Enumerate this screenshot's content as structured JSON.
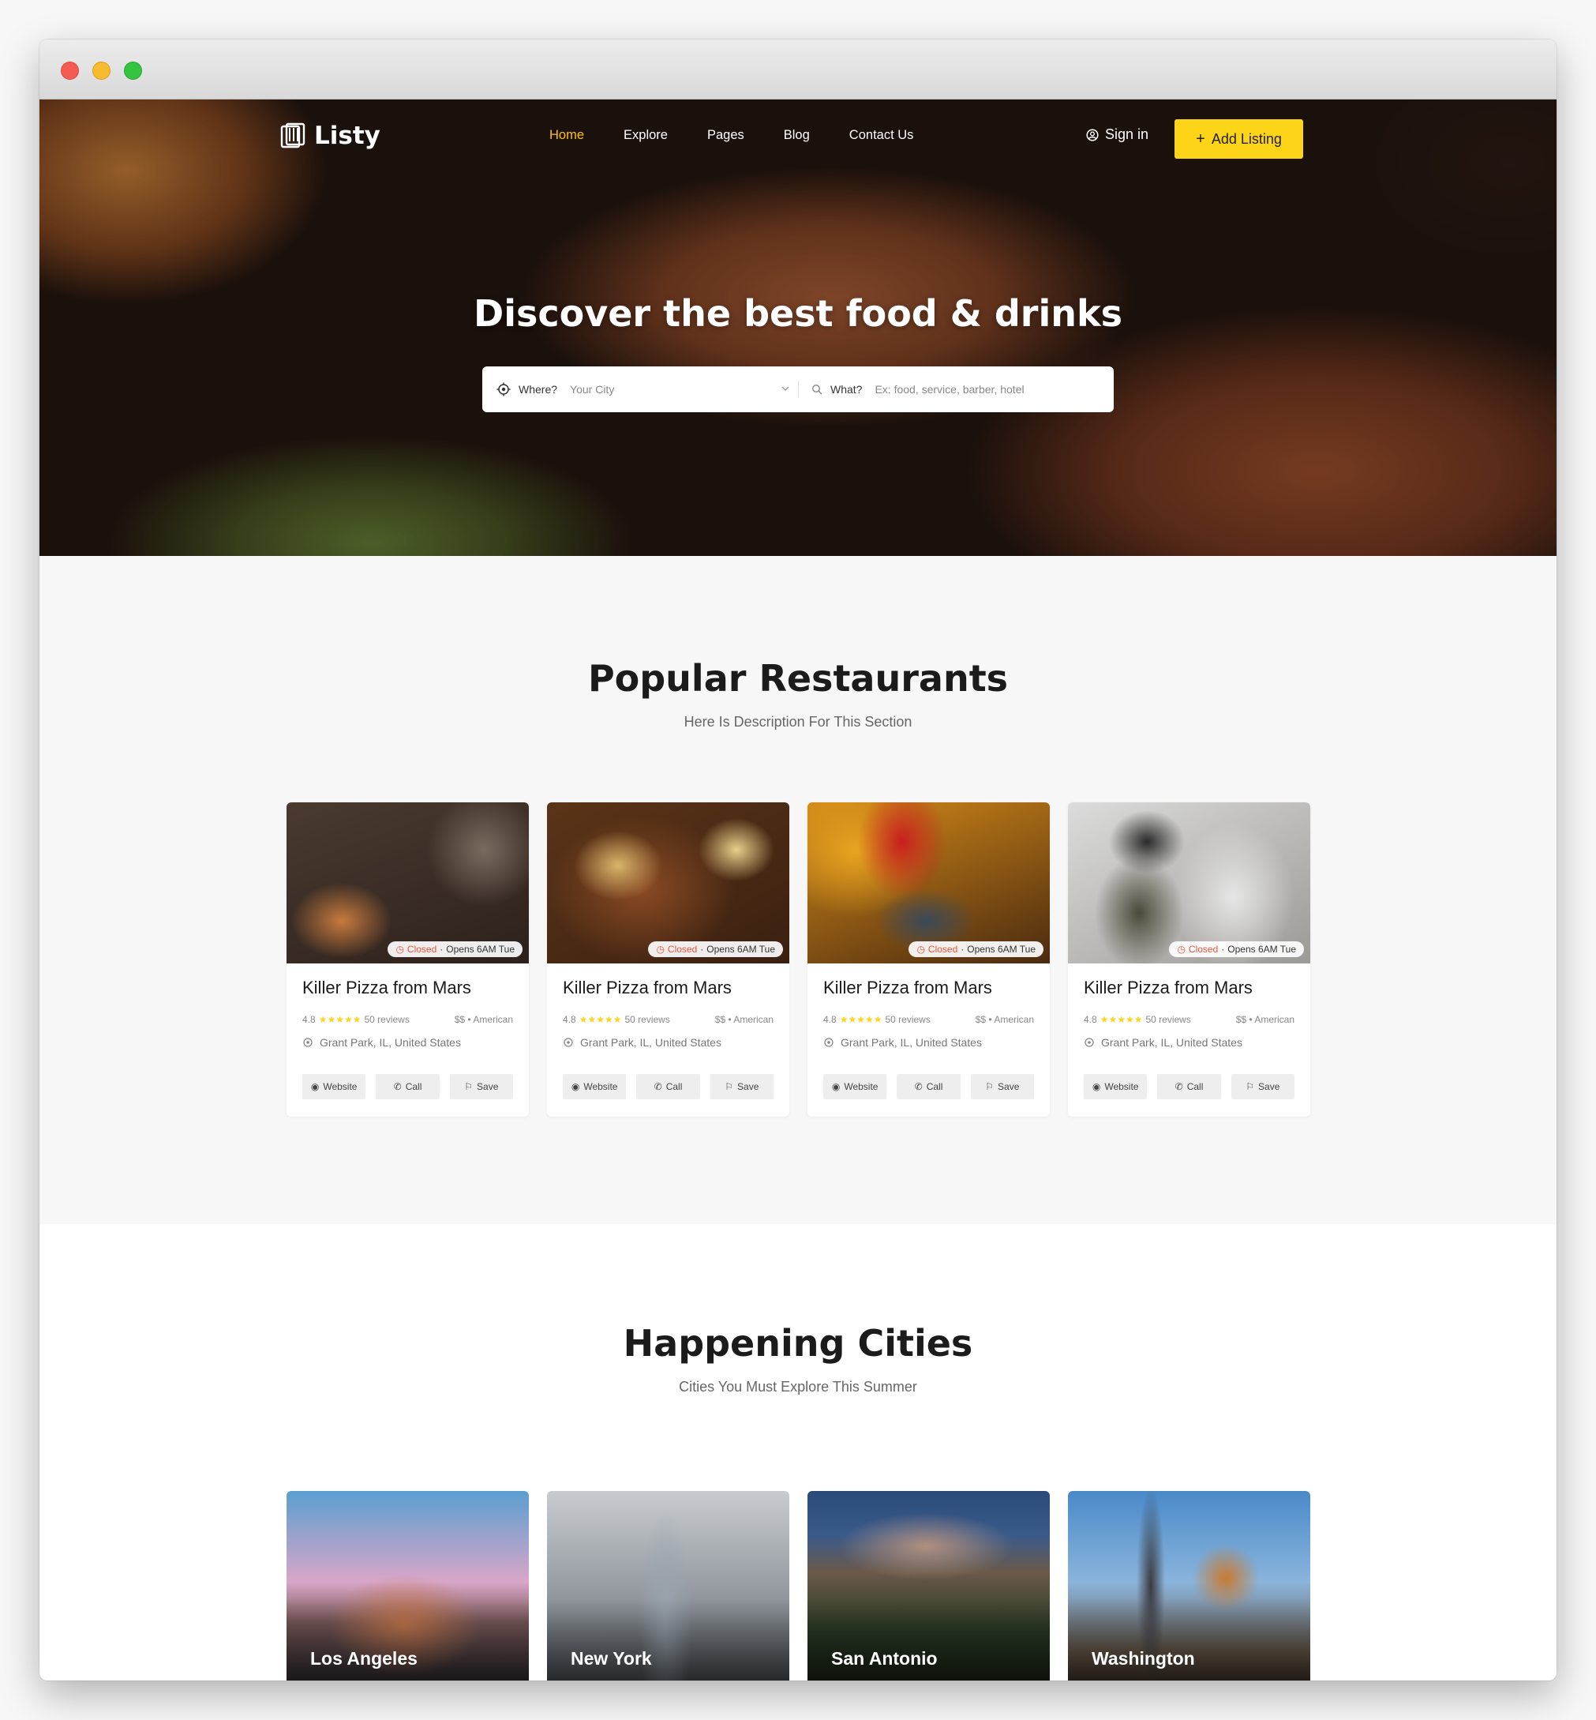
{
  "brand": {
    "name": "Listy"
  },
  "nav": {
    "items": [
      {
        "label": "Home",
        "active": true
      },
      {
        "label": "Explore",
        "active": false
      },
      {
        "label": "Pages",
        "active": false
      },
      {
        "label": "Blog",
        "active": false
      },
      {
        "label": "Contact Us",
        "active": false
      }
    ],
    "signin_label": "Sign in",
    "add_listing_label": "Add Listing"
  },
  "hero": {
    "title": "Discover the best food & drinks",
    "search": {
      "where_label": "Where?",
      "where_placeholder": "Your City",
      "what_label": "What?",
      "what_placeholder": "Ex: food, service, barber, hotel"
    }
  },
  "popular": {
    "title": "Popular Restaurants",
    "description": "Here Is Description For This Section",
    "cards": [
      {
        "name": "Killer Pizza from Mars",
        "status": "Closed",
        "hours": "Opens 6AM Tue",
        "rating": "4.8",
        "stars": "★★★★★",
        "reviews": "50 reviews",
        "price": "$$",
        "cuisine": "American",
        "location": "Grant Park, IL, United States",
        "website_label": "Website",
        "call_label": "Call",
        "save_label": "Save"
      },
      {
        "name": "Killer Pizza from Mars",
        "status": "Closed",
        "hours": "Opens 6AM Tue",
        "rating": "4.8",
        "stars": "★★★★★",
        "reviews": "50 reviews",
        "price": "$$",
        "cuisine": "American",
        "location": "Grant Park, IL, United States",
        "website_label": "Website",
        "call_label": "Call",
        "save_label": "Save"
      },
      {
        "name": "Killer Pizza from Mars",
        "status": "Closed",
        "hours": "Opens 6AM Tue",
        "rating": "4.8",
        "stars": "★★★★★",
        "reviews": "50 reviews",
        "price": "$$",
        "cuisine": "American",
        "location": "Grant Park, IL, United States",
        "website_label": "Website",
        "call_label": "Call",
        "save_label": "Save"
      },
      {
        "name": "Killer Pizza from Mars",
        "status": "Closed",
        "hours": "Opens 6AM Tue",
        "rating": "4.8",
        "stars": "★★★★★",
        "reviews": "50 reviews",
        "price": "$$",
        "cuisine": "American",
        "location": "Grant Park, IL, United States",
        "website_label": "Website",
        "call_label": "Call",
        "save_label": "Save"
      }
    ]
  },
  "cities": {
    "title": "Happening Cities",
    "description": "Cities You Must Explore This Summer",
    "items": [
      {
        "name": "Los Angeles"
      },
      {
        "name": "New York"
      },
      {
        "name": "San Antonio"
      },
      {
        "name": "Washington"
      }
    ]
  },
  "colors": {
    "accent": "#fed419",
    "nav_active": "#ffc107",
    "closed": "#e8553e"
  }
}
